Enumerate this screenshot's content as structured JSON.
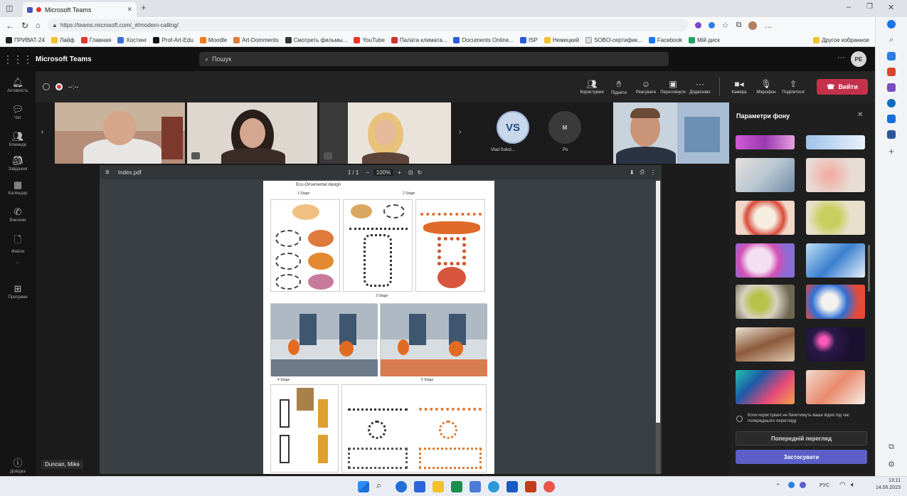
{
  "browser": {
    "tab_title": "Microsoft Teams",
    "url": "https://teams.microsoft.com/_#/modern-calling/",
    "bookmarks": [
      "ПРИВАТ-24",
      "Лайф",
      "Главная",
      "Хостинг",
      "Prof-Art-Edu",
      "Moodle",
      "Art-Domments",
      "Смотреть фильмы...",
      "YouTube",
      "Палата климата...",
      "Documents Online...",
      "ISP",
      "Немецкий",
      "SOBO-сертифик...",
      "Facebook",
      "Мій диск"
    ],
    "bookmarks_more": "Другое избранное"
  },
  "teams": {
    "app_name": "Microsoft Teams",
    "search_placeholder": "Пошук",
    "user_initials": "РЕ",
    "call_time": "--:--",
    "rail": [
      "Активність",
      "Чат",
      "Команди",
      "Завдання",
      "Календар",
      "Виклики",
      "Файли",
      "...",
      "Програми",
      "Довідка"
    ],
    "call_controls": [
      "Користувачі",
      "Підняти",
      "Реагувати",
      "Переглянути",
      "Додатково",
      "Камера",
      "Мікрофон",
      "Поділитися"
    ],
    "leave_label": "Вийти",
    "participants": [
      {
        "initials": "VS",
        "name": "Vlad Sokol..."
      },
      {
        "initials": "M",
        "name": "Po"
      }
    ],
    "presenter_name": "Duncan, Mike"
  },
  "shared": {
    "file_name": "Index.pdf",
    "page_info": "1 / 1",
    "zoom": "100%",
    "doc_title": "Eco-Ornamental design",
    "captions": [
      "1 Stage",
      "2 Stage",
      "3 Stage",
      "4 Stage",
      "5 Stage"
    ]
  },
  "background_panel": {
    "title": "Параметри фону",
    "checkbox_label": "Коли користувачі не бачитимуть ваше відео під час попереднього перегляду",
    "preview_label": "Попередній перегляд",
    "apply_label": "Застосувати"
  },
  "taskbar": {
    "lang": "РУС",
    "time": "13:11",
    "date": "14.06.2023"
  },
  "colors": {
    "teams_purple": "#5b5fc7",
    "leave_red": "#c4314b"
  }
}
